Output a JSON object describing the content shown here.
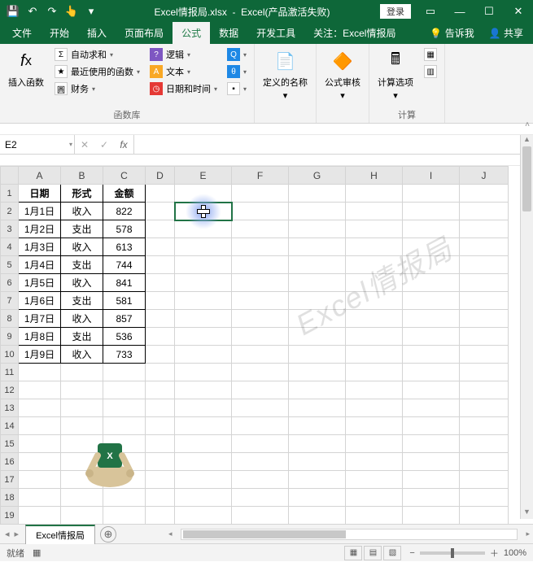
{
  "title": {
    "filename": "Excel情报局.xlsx",
    "app": "Excel(产品激活失败)",
    "login": "登录"
  },
  "qat": {
    "save": "💾",
    "undo": "↶",
    "redo": "↷",
    "touch": "👆"
  },
  "tabs": {
    "file": "文件",
    "home": "开始",
    "insert": "插入",
    "layout": "页面布局",
    "formula": "公式",
    "data": "数据",
    "dev": "开发工具",
    "follow": "关注：Excel情报局",
    "tell": "告诉我",
    "share": "共享"
  },
  "ribbon": {
    "insert_fn": "插入函数",
    "autosum": "自动求和",
    "recent": "最近使用的函数",
    "financial": "财务",
    "logical": "逻辑",
    "text": "文本",
    "datetime": "日期和时间",
    "defname": "定义的名称",
    "audit": "公式审核",
    "calcopt": "计算选项",
    "lib_label": "函数库",
    "calc_label": "计算"
  },
  "namebox": "E2",
  "headers": {
    "A": "日期",
    "B": "形式",
    "C": "金额"
  },
  "rows": [
    {
      "d": "1月1日",
      "t": "收入",
      "v": "822"
    },
    {
      "d": "1月2日",
      "t": "支出",
      "v": "578"
    },
    {
      "d": "1月3日",
      "t": "收入",
      "v": "613"
    },
    {
      "d": "1月4日",
      "t": "支出",
      "v": "744"
    },
    {
      "d": "1月5日",
      "t": "收入",
      "v": "841"
    },
    {
      "d": "1月6日",
      "t": "支出",
      "v": "581"
    },
    {
      "d": "1月7日",
      "t": "收入",
      "v": "857"
    },
    {
      "d": "1月8日",
      "t": "支出",
      "v": "536"
    },
    {
      "d": "1月9日",
      "t": "收入",
      "v": "733"
    }
  ],
  "cols": [
    "A",
    "B",
    "C",
    "D",
    "E",
    "F",
    "G",
    "H",
    "I",
    "J"
  ],
  "row_count": 19,
  "sheet": {
    "name": "Excel情报局"
  },
  "status": {
    "ready": "就绪",
    "zoom": "100%"
  },
  "watermark": "Excel情报局"
}
